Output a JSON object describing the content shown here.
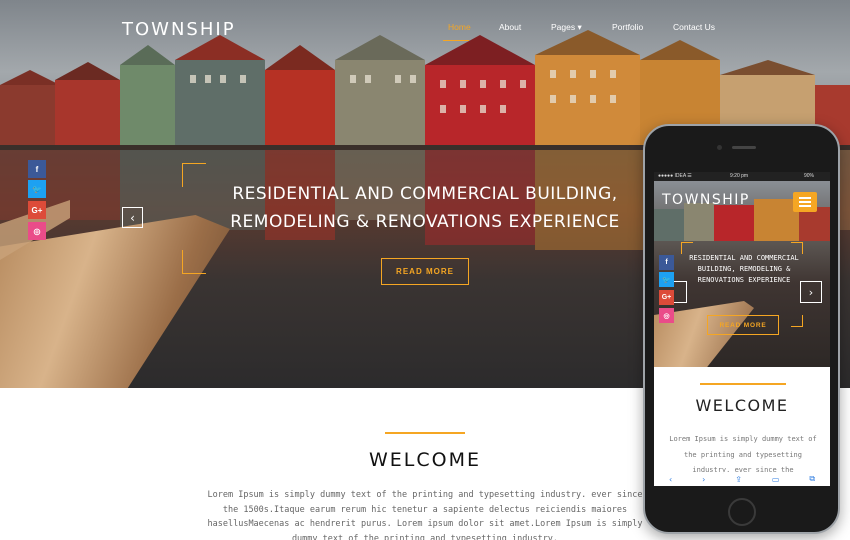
{
  "site": {
    "brand": "TOWNSHIP"
  },
  "nav": {
    "items": [
      "Home",
      "About",
      "Pages",
      "Portfolio",
      "Contact Us"
    ],
    "active": "Home"
  },
  "social": [
    "f",
    "t",
    "G+",
    "◎"
  ],
  "hero": {
    "title_line1": "RESIDENTIAL AND COMMERCIAL BUILDING,",
    "title_line2": "REMODELING & RENOVATIONS EXPERIENCE",
    "cta": "READ MORE",
    "prev_icon": "‹"
  },
  "welcome": {
    "title": "WELCOME",
    "text": "Lorem Ipsum is simply dummy text of the printing and typesetting industry. ever since the 1500s.Itaque earum rerum hic tenetur a sapiente delectus reiciendis maiores hasellusMaecenas ac hendrerit purus. Lorem ipsum dolor sit amet.Lorem Ipsum is simply dummy text of the printing and typesetting industry."
  },
  "phone": {
    "status_carrier": "●●●●● IDEA ☰",
    "status_time": "9:20 pm",
    "status_battery": "90%",
    "brand": "TOWNSHIP",
    "hero_title": "RESIDENTIAL AND COMMERCIAL BUILDING, REMODELING & RENOVATIONS EXPERIENCE",
    "cta": "READ MORE",
    "next_icon": "›",
    "welcome": "WELCOME",
    "text": "Lorem Ipsum is simply dummy text of the printing and typesetting industry. ever since the"
  },
  "colors": {
    "accent": "#f5a623",
    "facebook": "#3b5998",
    "twitter": "#1da1f2",
    "googleplus": "#dd4b39",
    "dribbble": "#ea4c89"
  }
}
